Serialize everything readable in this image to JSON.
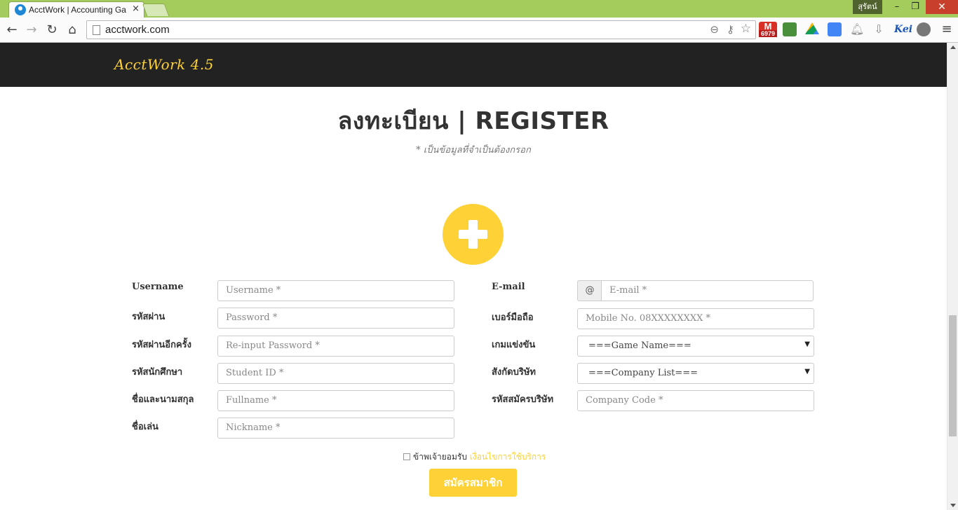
{
  "browser": {
    "tab_title": "AcctWork | Accounting Ga",
    "tab_close": "×",
    "url": "acctwork.com",
    "user_name": "สุรัตน์",
    "gmail_count": "6979",
    "gmail_letter": "M",
    "icons": [
      "back-icon",
      "forward-icon",
      "reload-icon",
      "home-icon",
      "zoom-icon",
      "key-icon",
      "star-icon",
      "gmail-icon",
      "save-icon",
      "drive-icon",
      "translate-icon",
      "bell-icon",
      "download-icon",
      "kei-icon",
      "film-icon",
      "menu-icon"
    ],
    "controls": {
      "back": "←",
      "forward": "→",
      "reload": "↻",
      "home": "⌂",
      "zoom": "⊖",
      "key": "⚷",
      "star": "☆",
      "bell": "♫",
      "download": "⇩",
      "kei": "Kei",
      "menu": "≡",
      "minimize": "–",
      "maximize": "❐",
      "close": "✕"
    }
  },
  "site": {
    "brand": "AcctWork 4.5",
    "brand_color": "#fed136",
    "navbar_color": "#222222"
  },
  "page": {
    "title": "ลงทะเบียน | REGISTER",
    "subtitle": "* เป็นข้อมูลที่จำเป็นต้องกรอก",
    "accent_color": "#fed136"
  },
  "form": {
    "left": [
      {
        "label": "Username",
        "placeholder": "Username *"
      },
      {
        "label": "รหัสผ่าน",
        "placeholder": "Password *"
      },
      {
        "label": "รหัสผ่านอีกครั้ง",
        "placeholder": "Re-input Password *"
      },
      {
        "label": "รหัสนักศึกษา",
        "placeholder": "Student ID *"
      },
      {
        "label": "ชื่อและนามสกุล",
        "placeholder": "Fullname *"
      },
      {
        "label": "ชื่อเล่น",
        "placeholder": "Nickname *"
      }
    ],
    "right": [
      {
        "label": "E-mail",
        "placeholder": "E-mail *",
        "addon": "@"
      },
      {
        "label": "เบอร์มือถือ",
        "placeholder": "Mobile No. 08XXXXXXXX *"
      },
      {
        "label": "เกมแข่งขัน",
        "selected": "===Game Name==="
      },
      {
        "label": "สังกัดบริษัท",
        "selected": "===Company List==="
      },
      {
        "label": "รหัสสมัครบริษัท",
        "placeholder": "Company Code *"
      }
    ],
    "terms_prefix": "ข้าพเจ้ายอมรับ",
    "terms_link": "เงื่อนไขการใช้บริการ",
    "submit_label": "สมัครสมาชิก",
    "select_caret": "▼"
  }
}
